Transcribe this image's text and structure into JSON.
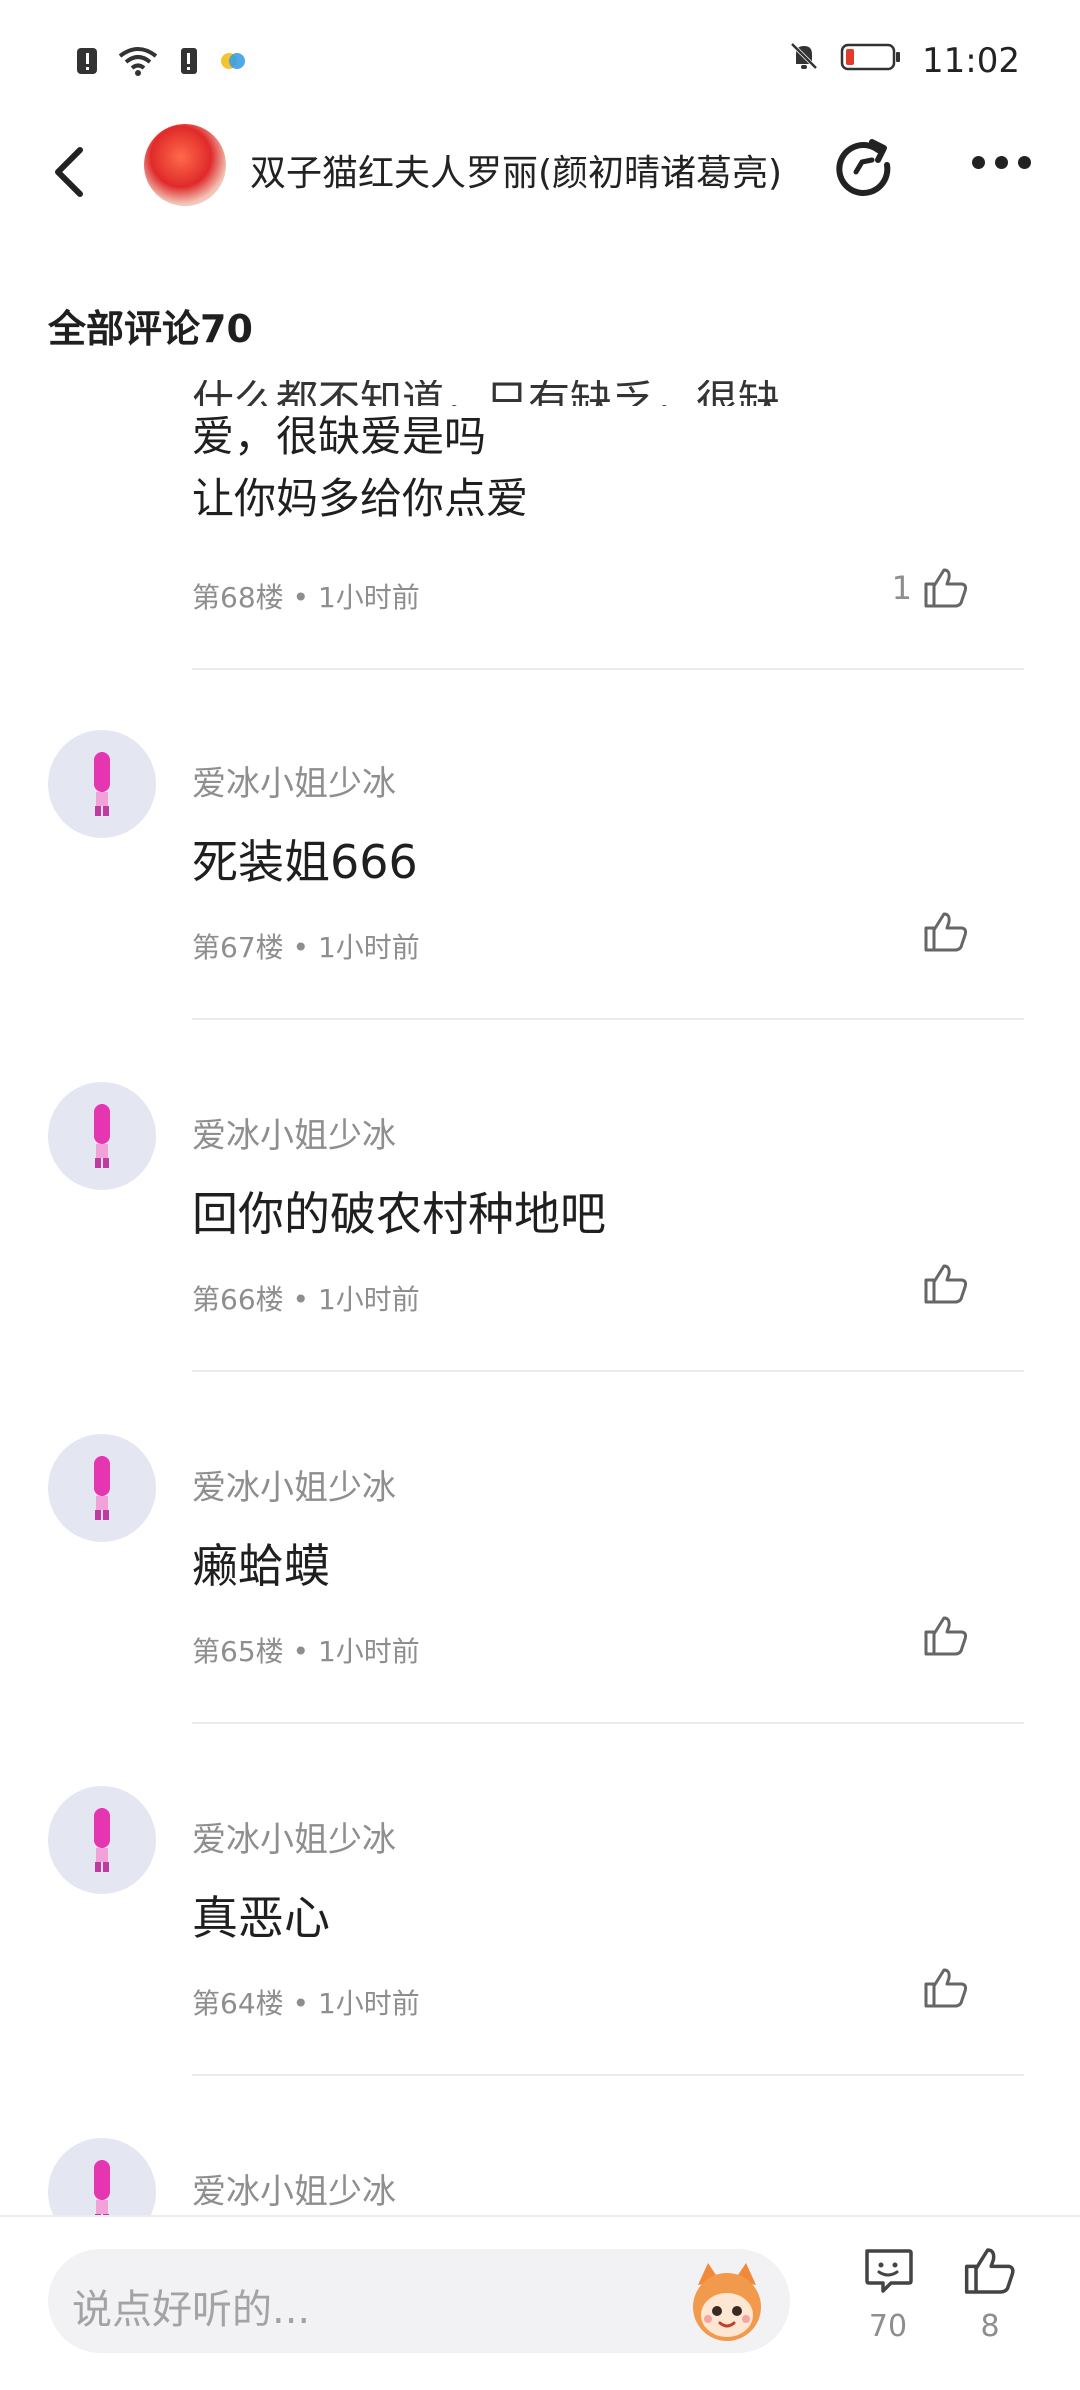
{
  "status_bar": {
    "time": "11:02"
  },
  "header": {
    "title": "双子猫红夫人罗丽(颜初晴诸葛亮)"
  },
  "section_title": "全部评论70",
  "partial_comment": {
    "lines": [
      "什么都不知道，只有缺乏，很缺",
      "爱，很缺爱是吗",
      "让你妈多给你点爱"
    ],
    "meta": "第68楼 • 1小时前",
    "likes": "1"
  },
  "comments": [
    {
      "user": "爱冰小姐少冰",
      "text": "死装姐666",
      "meta": "第67楼 • 1小时前"
    },
    {
      "user": "爱冰小姐少冰",
      "text": "回你的破农村种地吧",
      "meta": "第66楼 • 1小时前"
    },
    {
      "user": "爱冰小姐少冰",
      "text": "癞蛤蟆",
      "meta": "第65楼 • 1小时前"
    },
    {
      "user": "爱冰小姐少冰",
      "text": "真恶心",
      "meta": "第64楼 • 1小时前"
    },
    {
      "user": "爱冰小姐少冰",
      "text": "",
      "meta": ""
    }
  ],
  "bottom_bar": {
    "input_placeholder": "说点好听的...",
    "comment_count": "70",
    "like_count": "8"
  },
  "icons": {
    "back": "back-arrow-icon",
    "share": "share-icon",
    "more": "more-icon",
    "like": "thumbs-up-icon",
    "comment": "comment-icon"
  },
  "colors": {
    "accent_text": "#1f1f1f",
    "muted_text": "#8e8e8e",
    "divider": "#ececec"
  }
}
